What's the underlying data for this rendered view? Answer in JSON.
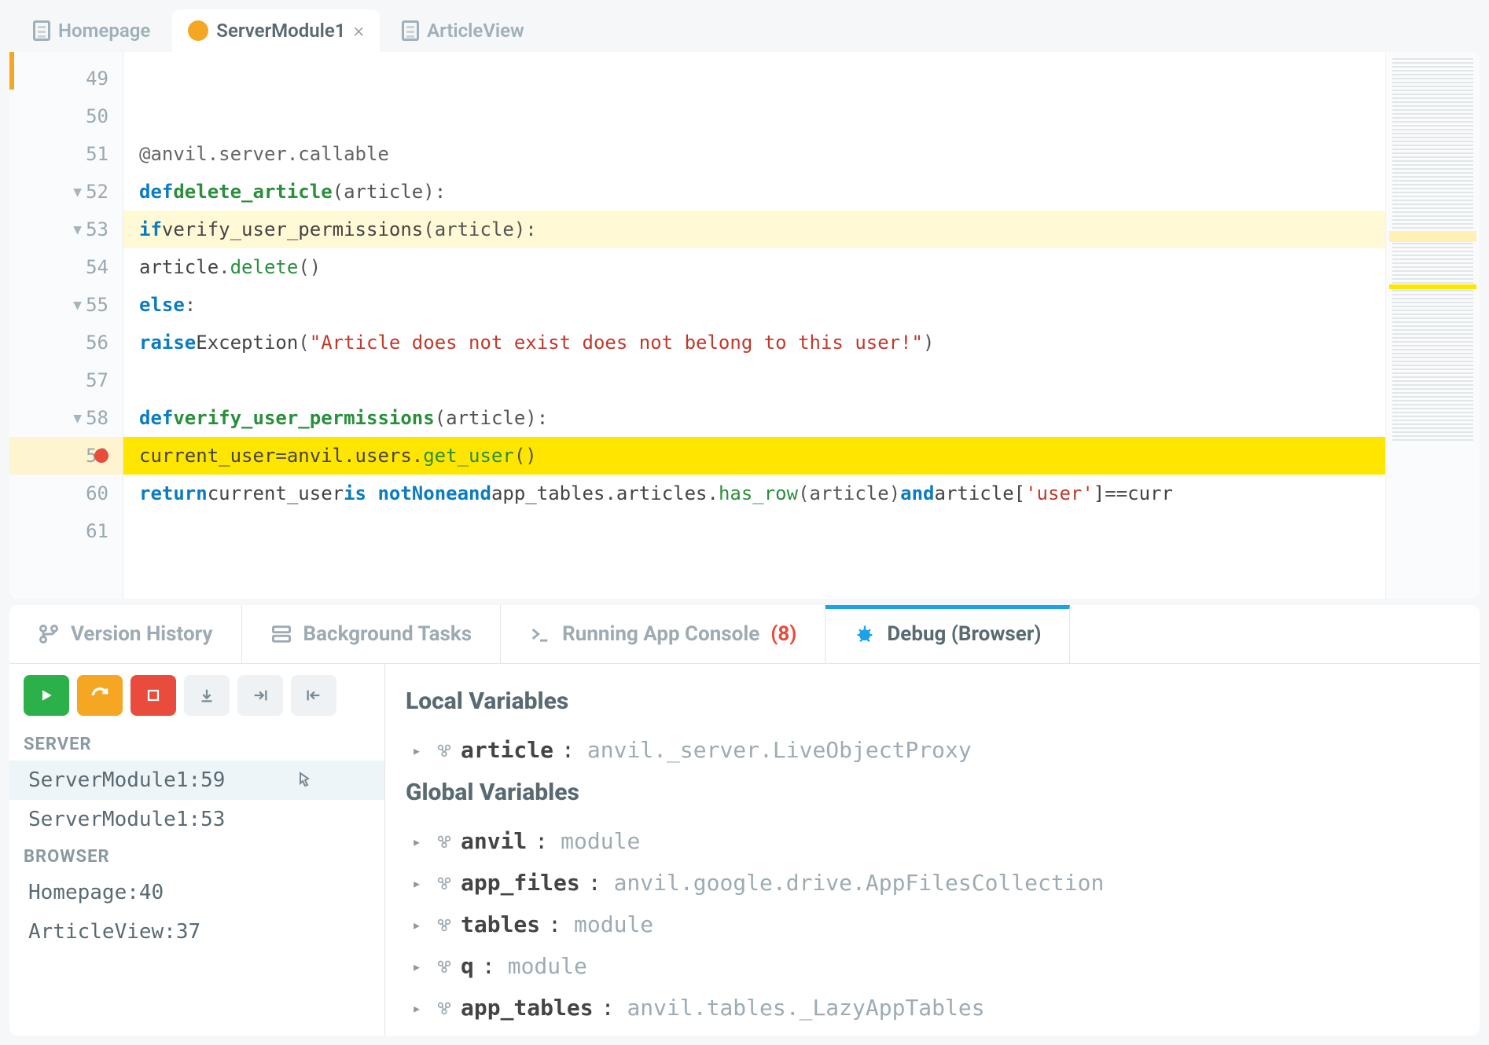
{
  "tabs": [
    {
      "label": "Homepage",
      "active": false,
      "closable": false
    },
    {
      "label": "ServerModule1",
      "active": true,
      "closable": true
    },
    {
      "label": "ArticleView",
      "active": false,
      "closable": false
    }
  ],
  "code": {
    "lines": [
      {
        "num": "49",
        "html": ""
      },
      {
        "num": "50",
        "html": ""
      },
      {
        "num": "51",
        "html": "<span class='tok-at'>@anvil.server.callable</span>"
      },
      {
        "num": "52",
        "fold": true,
        "html": "<span class='tok-kw'>def</span> <span class='tok-def'>delete_article</span><span class='tok-punc'>(article):</span>"
      },
      {
        "num": "53",
        "fold": true,
        "step": true,
        "html": "  <span class='tok-kw'>if</span> <span class='tok-var'>verify_user_permissions</span><span class='tok-punc'>(article):</span>"
      },
      {
        "num": "54",
        "html": "    <span class='tok-var'>article</span><span class='tok-punc'>.</span><span class='tok-method'>delete</span><span class='tok-punc'>()</span>"
      },
      {
        "num": "55",
        "fold": true,
        "html": "  <span class='tok-kw'>else</span><span class='tok-punc'>:</span>"
      },
      {
        "num": "56",
        "html": "    <span class='tok-kw'>raise</span> <span class='tok-var'>Exception</span><span class='tok-punc'>(</span><span class='tok-str'>\"Article does not exist does not belong to this user!\"</span><span class='tok-punc'>)</span>"
      },
      {
        "num": "57",
        "html": ""
      },
      {
        "num": "58",
        "fold": true,
        "html": "<span class='tok-kw'>def</span> <span class='tok-def'>verify_user_permissions</span><span class='tok-punc'>(article):</span>"
      },
      {
        "num": "59",
        "bp": true,
        "current": true,
        "html": "  <span class='tok-var'>current_user</span> <span class='tok-punc'>=</span> <span class='tok-var'>anvil.users.</span><span class='tok-prop'>get_user</span><span class='tok-punc'>()</span>"
      },
      {
        "num": "60",
        "html": "  <span class='tok-kw'>return</span> <span class='tok-var'>current_user</span> <span class='tok-op'>is not</span> <span class='tok-kw'>None</span> <span class='tok-op'>and</span> <span class='tok-var'>app_tables.articles.</span><span class='tok-prop'>has_row</span><span class='tok-punc'>(article)</span> <span class='tok-op'>and</span> <span class='tok-var'>article[</span><span class='tok-strkey'>'user'</span><span class='tok-var'>]</span> <span class='tok-punc'>==</span> <span class='tok-var'>curr</span>"
      },
      {
        "num": "61",
        "html": ""
      }
    ]
  },
  "bottom_tabs": {
    "version_history": "Version History",
    "background_tasks": "Background Tasks",
    "running_console": "Running App Console",
    "running_console_count": "(8)",
    "debug": "Debug (Browser)"
  },
  "callstack": {
    "server_header": "SERVER",
    "browser_header": "BROWSER",
    "server": [
      {
        "label": "ServerModule1:59",
        "active": true,
        "cursor": true
      },
      {
        "label": "ServerModule1:53",
        "active": false
      }
    ],
    "browser": [
      {
        "label": "Homepage:40"
      },
      {
        "label": "ArticleView:37"
      }
    ]
  },
  "variables": {
    "local_title": "Local Variables",
    "global_title": "Global Variables",
    "local": [
      {
        "name": "article",
        "type": "anvil._server.LiveObjectProxy"
      }
    ],
    "global": [
      {
        "name": "anvil",
        "type": "module"
      },
      {
        "name": "app_files",
        "type": "anvil.google.drive.AppFilesCollection"
      },
      {
        "name": "tables",
        "type": "module"
      },
      {
        "name": "q",
        "type": "module"
      },
      {
        "name": "app_tables",
        "type": "anvil.tables._LazyAppTables"
      }
    ]
  }
}
